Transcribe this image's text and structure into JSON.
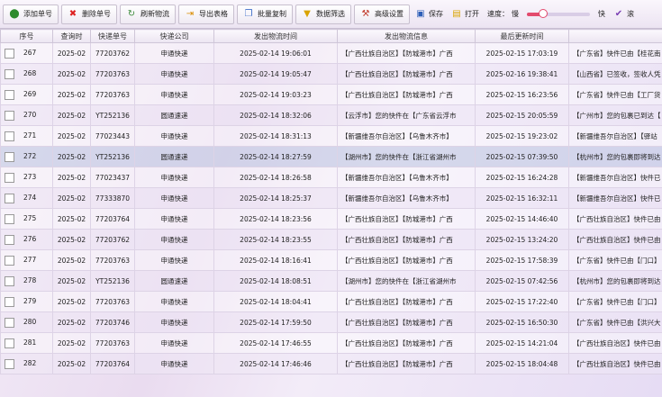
{
  "toolbar": {
    "add_label": "添加单号",
    "delete_label": "删除单号",
    "refresh_label": "刷新物流",
    "export_label": "导出表格",
    "copy_label": "批量复制",
    "filter_label": "数据筛选",
    "settings_label": "高级设置",
    "save_label": "保存",
    "open_label": "打开",
    "speed_label": "速度：",
    "slow_label": "慢",
    "fast_label": "快",
    "speed_level": 0.25,
    "scroll_label": "滚"
  },
  "columns": [
    "序号",
    "查询时",
    "快递单号",
    "快递公司",
    "发出物流时间",
    "发出物流信息",
    "最后更新时间",
    "最后"
  ],
  "rows": [
    {
      "idx": "267",
      "qtime": "2025-02",
      "no": "77203762",
      "co": "申通快递",
      "stime": "2025-02-14 19:06:01",
      "sinfo": "【广西壮族自治区】【防城港市】广西",
      "ltime": "2025-02-15 17:03:19",
      "linfo": "【广东省】快件已由【桂花南"
    },
    {
      "idx": "268",
      "qtime": "2025-02",
      "no": "77203763",
      "co": "申通快递",
      "stime": "2025-02-14 19:05:47",
      "sinfo": "【广西壮族自治区】【防城港市】广西",
      "ltime": "2025-02-16 19:38:41",
      "linfo": "【山西省】已签收，签收人凭"
    },
    {
      "idx": "269",
      "qtime": "2025-02",
      "no": "77203763",
      "co": "申通快递",
      "stime": "2025-02-14 19:03:23",
      "sinfo": "【广西壮族自治区】【防城港市】广西",
      "ltime": "2025-02-15 16:23:56",
      "linfo": "【广东省】快件已由【工厂货"
    },
    {
      "idx": "270",
      "qtime": "2025-02",
      "no": "YT252136",
      "co": "圆通速递",
      "stime": "2025-02-14 18:32:06",
      "sinfo": "【云浮市】您的快件在【广东省云浮市",
      "ltime": "2025-02-15 20:05:59",
      "linfo": "【广州市】您的包裹已到达【"
    },
    {
      "idx": "271",
      "qtime": "2025-02",
      "no": "77023443",
      "co": "申通快递",
      "stime": "2025-02-14 18:31:13",
      "sinfo": "【新疆维吾尔自治区】【乌鲁木齐市】",
      "ltime": "2025-02-15 19:23:02",
      "linfo": "【新疆维吾尔自治区】【驿站"
    },
    {
      "idx": "272",
      "qtime": "2025-02",
      "no": "YT252136",
      "co": "圆通速递",
      "stime": "2025-02-14 18:27:59",
      "sinfo": "【湖州市】您的快件在【浙江省湖州市",
      "ltime": "2025-02-15 07:39:50",
      "linfo": "【杭州市】您的包裹即将到达"
    },
    {
      "idx": "273",
      "qtime": "2025-02",
      "no": "77023437",
      "co": "申通快递",
      "stime": "2025-02-14 18:26:58",
      "sinfo": "【新疆维吾尔自治区】【乌鲁木齐市】",
      "ltime": "2025-02-15 16:24:28",
      "linfo": "【新疆维吾尔自治区】快件已"
    },
    {
      "idx": "274",
      "qtime": "2025-02",
      "no": "77333870",
      "co": "申通快递",
      "stime": "2025-02-14 18:25:37",
      "sinfo": "【新疆维吾尔自治区】【乌鲁木齐市】",
      "ltime": "2025-02-15 16:32:11",
      "linfo": "【新疆维吾尔自治区】快件已"
    },
    {
      "idx": "275",
      "qtime": "2025-02",
      "no": "77203764",
      "co": "申通快递",
      "stime": "2025-02-14 18:23:56",
      "sinfo": "【广西壮族自治区】【防城港市】广西",
      "ltime": "2025-02-15 14:46:40",
      "linfo": "【广西壮族自治区】快件已由"
    },
    {
      "idx": "276",
      "qtime": "2025-02",
      "no": "77203762",
      "co": "申通快递",
      "stime": "2025-02-14 18:23:55",
      "sinfo": "【广西壮族自治区】【防城港市】广西",
      "ltime": "2025-02-15 13:24:20",
      "linfo": "【广西壮族自治区】快件已由"
    },
    {
      "idx": "277",
      "qtime": "2025-02",
      "no": "77203763",
      "co": "申通快递",
      "stime": "2025-02-14 18:16:41",
      "sinfo": "【广西壮族自治区】【防城港市】广西",
      "ltime": "2025-02-15 17:58:39",
      "linfo": "【广东省】快件已由【门口】"
    },
    {
      "idx": "278",
      "qtime": "2025-02",
      "no": "YT252136",
      "co": "圆通速递",
      "stime": "2025-02-14 18:08:51",
      "sinfo": "【湖州市】您的快件在【浙江省湖州市",
      "ltime": "2025-02-15 07:42:56",
      "linfo": "【杭州市】您的包裹即将到达"
    },
    {
      "idx": "279",
      "qtime": "2025-02",
      "no": "77203763",
      "co": "申通快递",
      "stime": "2025-02-14 18:04:41",
      "sinfo": "【广西壮族自治区】【防城港市】广西",
      "ltime": "2025-02-15 17:22:40",
      "linfo": "【广东省】快件已由【门口】"
    },
    {
      "idx": "280",
      "qtime": "2025-02",
      "no": "77203746",
      "co": "申通快递",
      "stime": "2025-02-14 17:59:50",
      "sinfo": "【广西壮族自治区】【防城港市】广西",
      "ltime": "2025-02-15 16:50:30",
      "linfo": "【广东省】快件已由【洪兴大"
    },
    {
      "idx": "281",
      "qtime": "2025-02",
      "no": "77203763",
      "co": "申通快递",
      "stime": "2025-02-14 17:46:55",
      "sinfo": "【广西壮族自治区】【防城港市】广西",
      "ltime": "2025-02-15 14:21:04",
      "linfo": "【广西壮族自治区】快件已由"
    },
    {
      "idx": "282",
      "qtime": "2025-02",
      "no": "77203764",
      "co": "申通快递",
      "stime": "2025-02-14 17:46:46",
      "sinfo": "【广西壮族自治区】【防城港市】广西",
      "ltime": "2025-02-15 18:04:48",
      "linfo": "【广西壮族自治区】快件已由"
    }
  ]
}
